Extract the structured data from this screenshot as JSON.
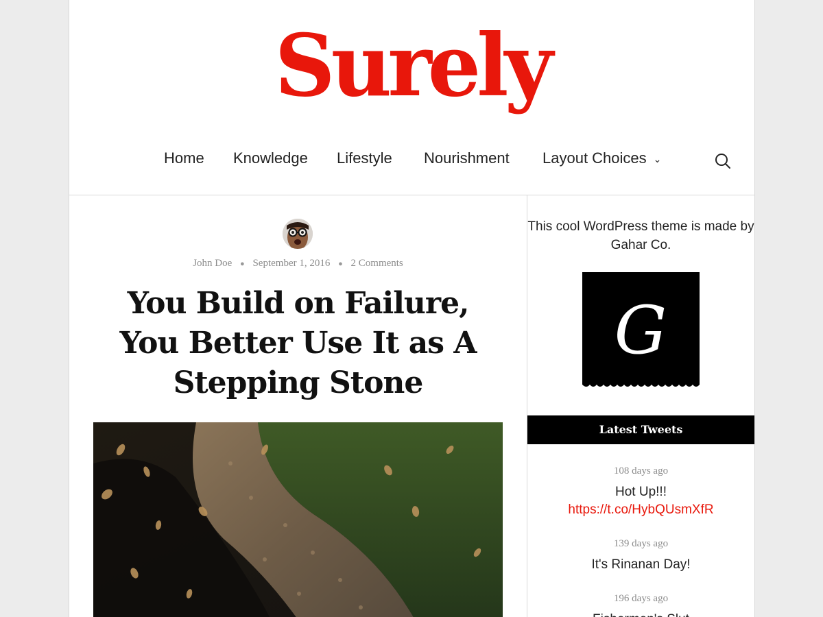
{
  "site": {
    "logo_text": "Surely",
    "brand_color": "#e8170b"
  },
  "nav": {
    "items": [
      {
        "label": "Home"
      },
      {
        "label": "Knowledge"
      },
      {
        "label": "Lifestyle"
      },
      {
        "label": "Nourishment"
      },
      {
        "label": "Layout Choices",
        "has_dropdown": true,
        "icon": "chevron-down-icon"
      }
    ],
    "search_icon": "search-icon"
  },
  "post": {
    "author": "John Doe",
    "date": "September 1, 2016",
    "comments": "2 Comments",
    "title": "You Build on Failure, You Better Use It as A Stepping Stone",
    "featured_image": "autumn leaves falling over a cobblestone path beside green hedges"
  },
  "sidebar": {
    "about_text": "This cool WordPress theme is made by Gahar Co.",
    "logo_letter": "G",
    "tweets_title": "Latest Tweets",
    "tweets": [
      {
        "time": "108 days ago",
        "text": "Hot Up!!!",
        "link": "https://t.co/HybQUsmXfR"
      },
      {
        "time": "139 days ago",
        "text": "It's Rinanan Day!"
      },
      {
        "time": "196 days ago",
        "text": "Fishermen's Slut"
      }
    ]
  }
}
